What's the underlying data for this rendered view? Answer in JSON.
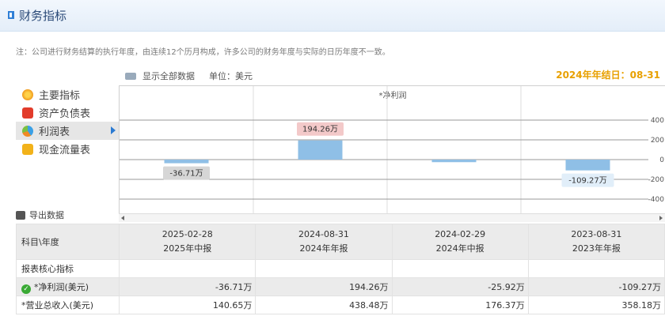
{
  "header": {
    "title": "财务指标"
  },
  "note": "注：公司进行财务结算的执行年度，由连续12个历月构成，许多公司的财务年度与实际的日历年度不一致。",
  "toolbar": {
    "show_all": "显示全部数据",
    "unit": "单位：美元"
  },
  "year_end": "2024年年结日：08-31",
  "sidebar": {
    "items": [
      {
        "label": "主要指标",
        "icon": "coin-icon"
      },
      {
        "label": "资产负债表",
        "icon": "document-icon"
      },
      {
        "label": "利润表",
        "icon": "pie-chart-icon",
        "active": true
      },
      {
        "label": "现金流量表",
        "icon": "cash-icon"
      }
    ],
    "export": "导出数据"
  },
  "chart_data": {
    "type": "bar",
    "title": "*净利润",
    "categories": [
      "2025-02-28",
      "2024-08-31",
      "2024-02-29",
      "2023-08-31"
    ],
    "values": [
      -36.71,
      194.26,
      -25.92,
      -109.27
    ],
    "data_labels": [
      "-36.71万",
      "194.26万",
      "",
      "-109.27万"
    ],
    "ylim": [
      -500,
      500
    ],
    "yticks": [
      400,
      200,
      0,
      -200,
      -400
    ],
    "color": "#8fbfe6",
    "label_colors": [
      "#d6d6d6",
      "#f3c9c9",
      "",
      "#e1eef9"
    ]
  },
  "table": {
    "header_label": "科目\\年度",
    "periods": [
      {
        "date": "2025-02-28",
        "name": "2025年中报"
      },
      {
        "date": "2024-08-31",
        "name": "2024年年报"
      },
      {
        "date": "2024-02-29",
        "name": "2024年中报"
      },
      {
        "date": "2023-08-31",
        "name": "2023年年报"
      }
    ],
    "section": "报表核心指标",
    "rows": [
      {
        "label": "*净利润(美元)",
        "values": [
          "-36.71万",
          "194.26万",
          "-25.92万",
          "-109.27万"
        ]
      },
      {
        "label": "*营业总收入(美元)",
        "values": [
          "140.65万",
          "438.48万",
          "176.37万",
          "358.18万"
        ]
      }
    ]
  }
}
